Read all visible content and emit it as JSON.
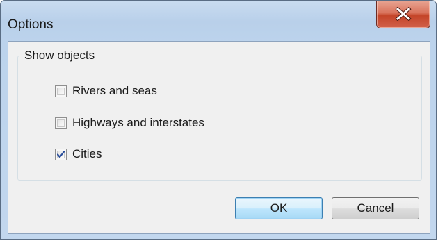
{
  "window": {
    "title": "Options"
  },
  "groupbox": {
    "label": "Show objects",
    "options": [
      {
        "label": "Rivers and seas",
        "checked": false
      },
      {
        "label": "Highways and interstates",
        "checked": false
      },
      {
        "label": "Cities",
        "checked": true
      }
    ]
  },
  "buttons": {
    "ok_label": "OK",
    "cancel_label": "Cancel"
  },
  "icons": {
    "close": "close-icon",
    "checkmark": "checkmark-icon"
  },
  "colors": {
    "close_button": "#c44428",
    "default_button_border": "#3c7fb1",
    "checkmark": "#2a4e9a"
  }
}
